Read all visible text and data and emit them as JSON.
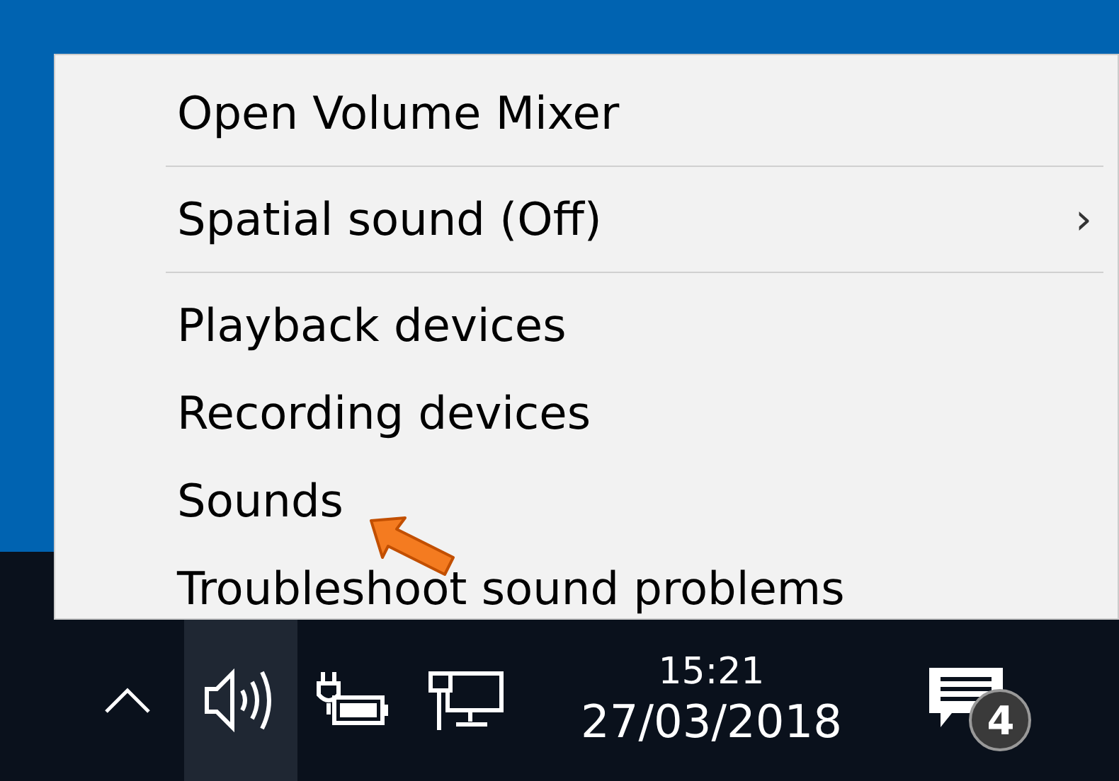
{
  "menu": {
    "items": [
      {
        "kind": "item",
        "label": "Open Volume Mixer"
      },
      {
        "kind": "separator"
      },
      {
        "kind": "item",
        "label": "Spatial sound (Off)",
        "submenu_arrow": "›"
      },
      {
        "kind": "separator"
      },
      {
        "kind": "item",
        "label": "Playback devices"
      },
      {
        "kind": "item",
        "label": "Recording devices"
      },
      {
        "kind": "item",
        "label": "Sounds"
      },
      {
        "kind": "item",
        "label": "Troubleshoot sound problems"
      }
    ]
  },
  "annotation": {
    "kind": "arrow"
  },
  "taskbar": {
    "tray": [
      {
        "kind": "chevron",
        "selected": false
      },
      {
        "kind": "speaker",
        "selected": true
      },
      {
        "kind": "battery",
        "selected": false
      },
      {
        "kind": "network",
        "selected": false
      }
    ],
    "clock": {
      "time": "15:21",
      "date": "27/03/2018"
    },
    "notifications": {
      "count": "4"
    }
  }
}
